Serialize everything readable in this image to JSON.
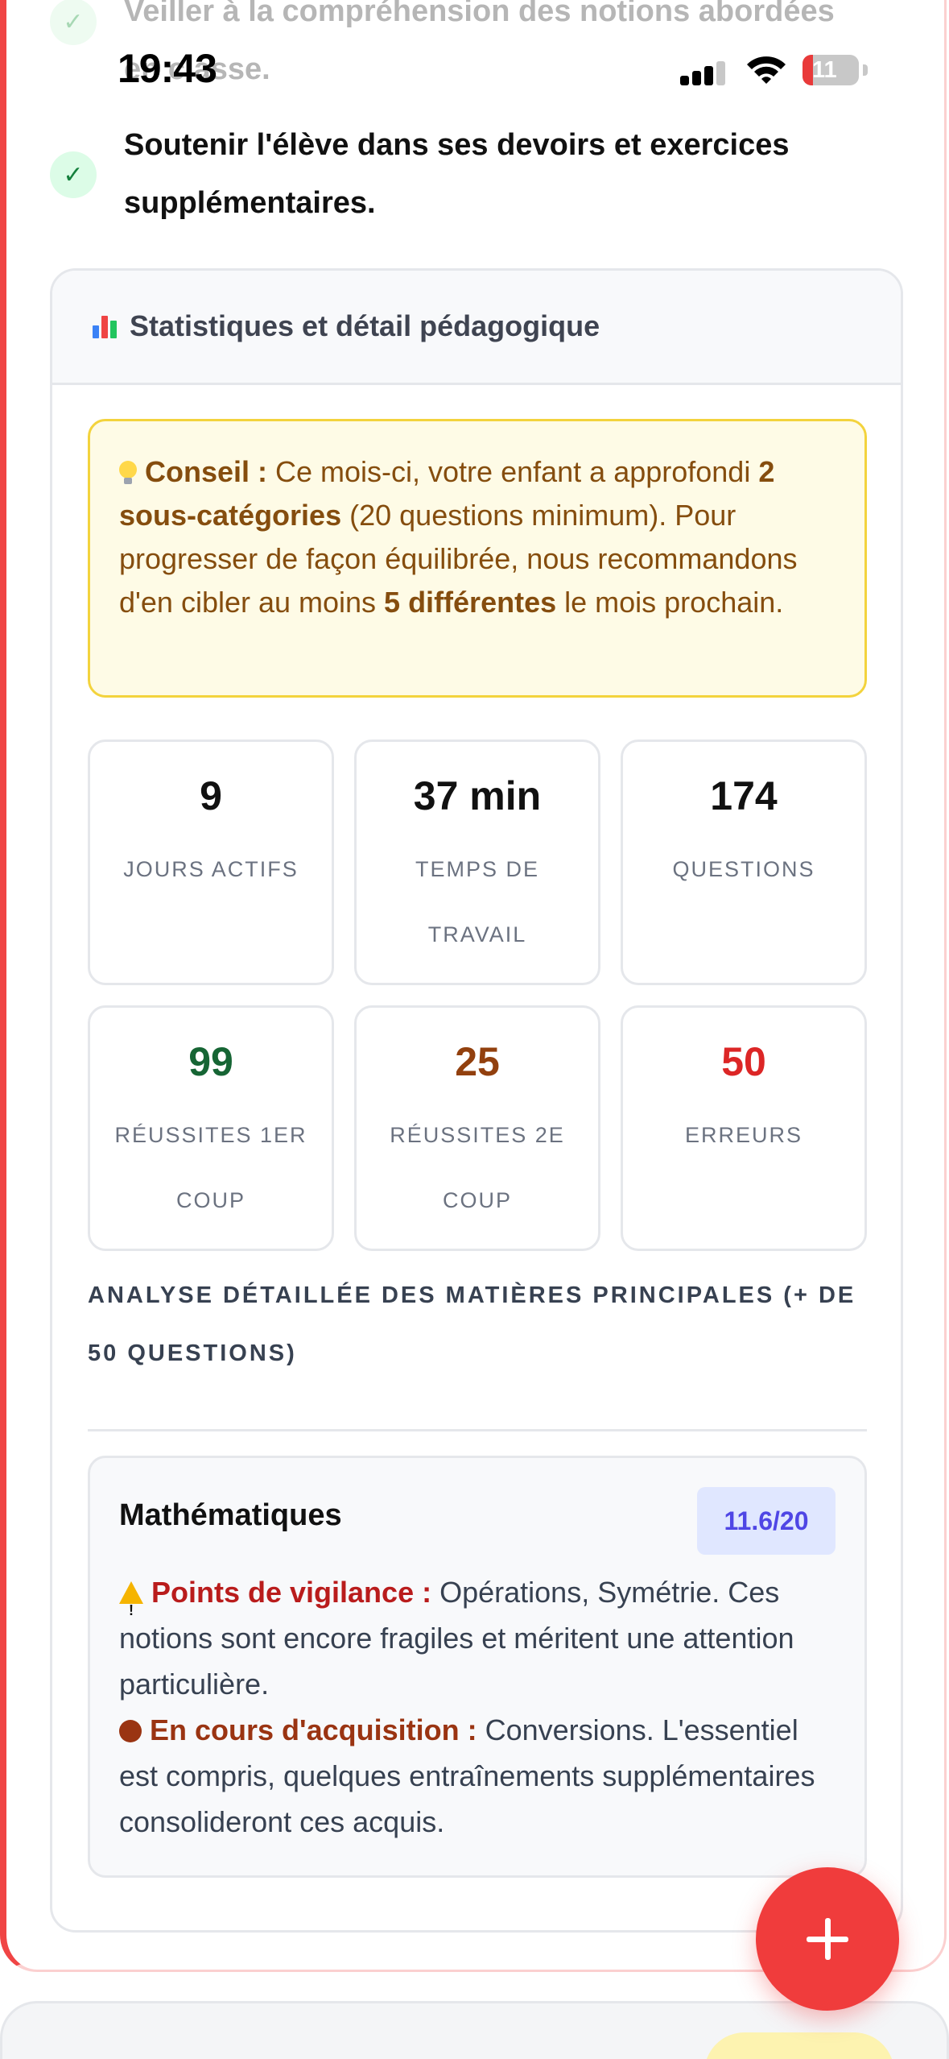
{
  "status_bar": {
    "time": "19:43",
    "battery_level": "11"
  },
  "objectives": [
    {
      "text": "Veiller à la compréhension des notions abordées en classe."
    },
    {
      "text": "Soutenir l'élève dans ses devoirs et exercices supplémentaires."
    }
  ],
  "stats_panel": {
    "title": "Statistiques et détail pédagogique",
    "tip": {
      "label": "Conseil :",
      "t1": " Ce mois-ci, votre enfant a approfondi ",
      "b1": "2 sous-catégories",
      "t2": " (20 questions minimum). Pour progresser de façon équilibrée, nous recommandons d'en cibler au moins ",
      "b2": "5 différentes",
      "t3": " le mois prochain."
    },
    "stats": [
      {
        "value": "9",
        "label": "JOURS ACTIFS",
        "color": "#111111"
      },
      {
        "value": "37 min",
        "label": "TEMPS DE TRAVAIL",
        "color": "#111111"
      },
      {
        "value": "174",
        "label": "QUESTIONS",
        "color": "#111111"
      },
      {
        "value": "99",
        "label": "RÉUSSITES 1ER COUP",
        "color": "#166534"
      },
      {
        "value": "25",
        "label": "RÉUSSITES 2E COUP",
        "color": "#92400e"
      },
      {
        "value": "50",
        "label": "ERREURS",
        "color": "#dc2626"
      }
    ],
    "section_title": "ANALYSE DÉTAILLÉE DES MATIÈRES PRINCIPALES (+ DE 50 QUESTIONS)",
    "subject": {
      "name": "Mathématiques",
      "grade": "11.6/20",
      "vigilance_label": "Points de vigilance :",
      "vigilance_text": " Opérations, Symétrie. Ces notions sont encore fragiles et méritent une attention particulière.",
      "acquisition_label": "En cours d'acquisition :",
      "acquisition_text": " Conversions. L'essentiel est compris, quelques entraînements supplémentaires consolideront ces acquis."
    }
  },
  "fab": {
    "icon": "plus-icon"
  },
  "colors": {
    "accent": "#f04545",
    "fab": "#f03c3c",
    "tip_bg": "#fefbe6",
    "grade_bg": "#e0e7ff"
  }
}
